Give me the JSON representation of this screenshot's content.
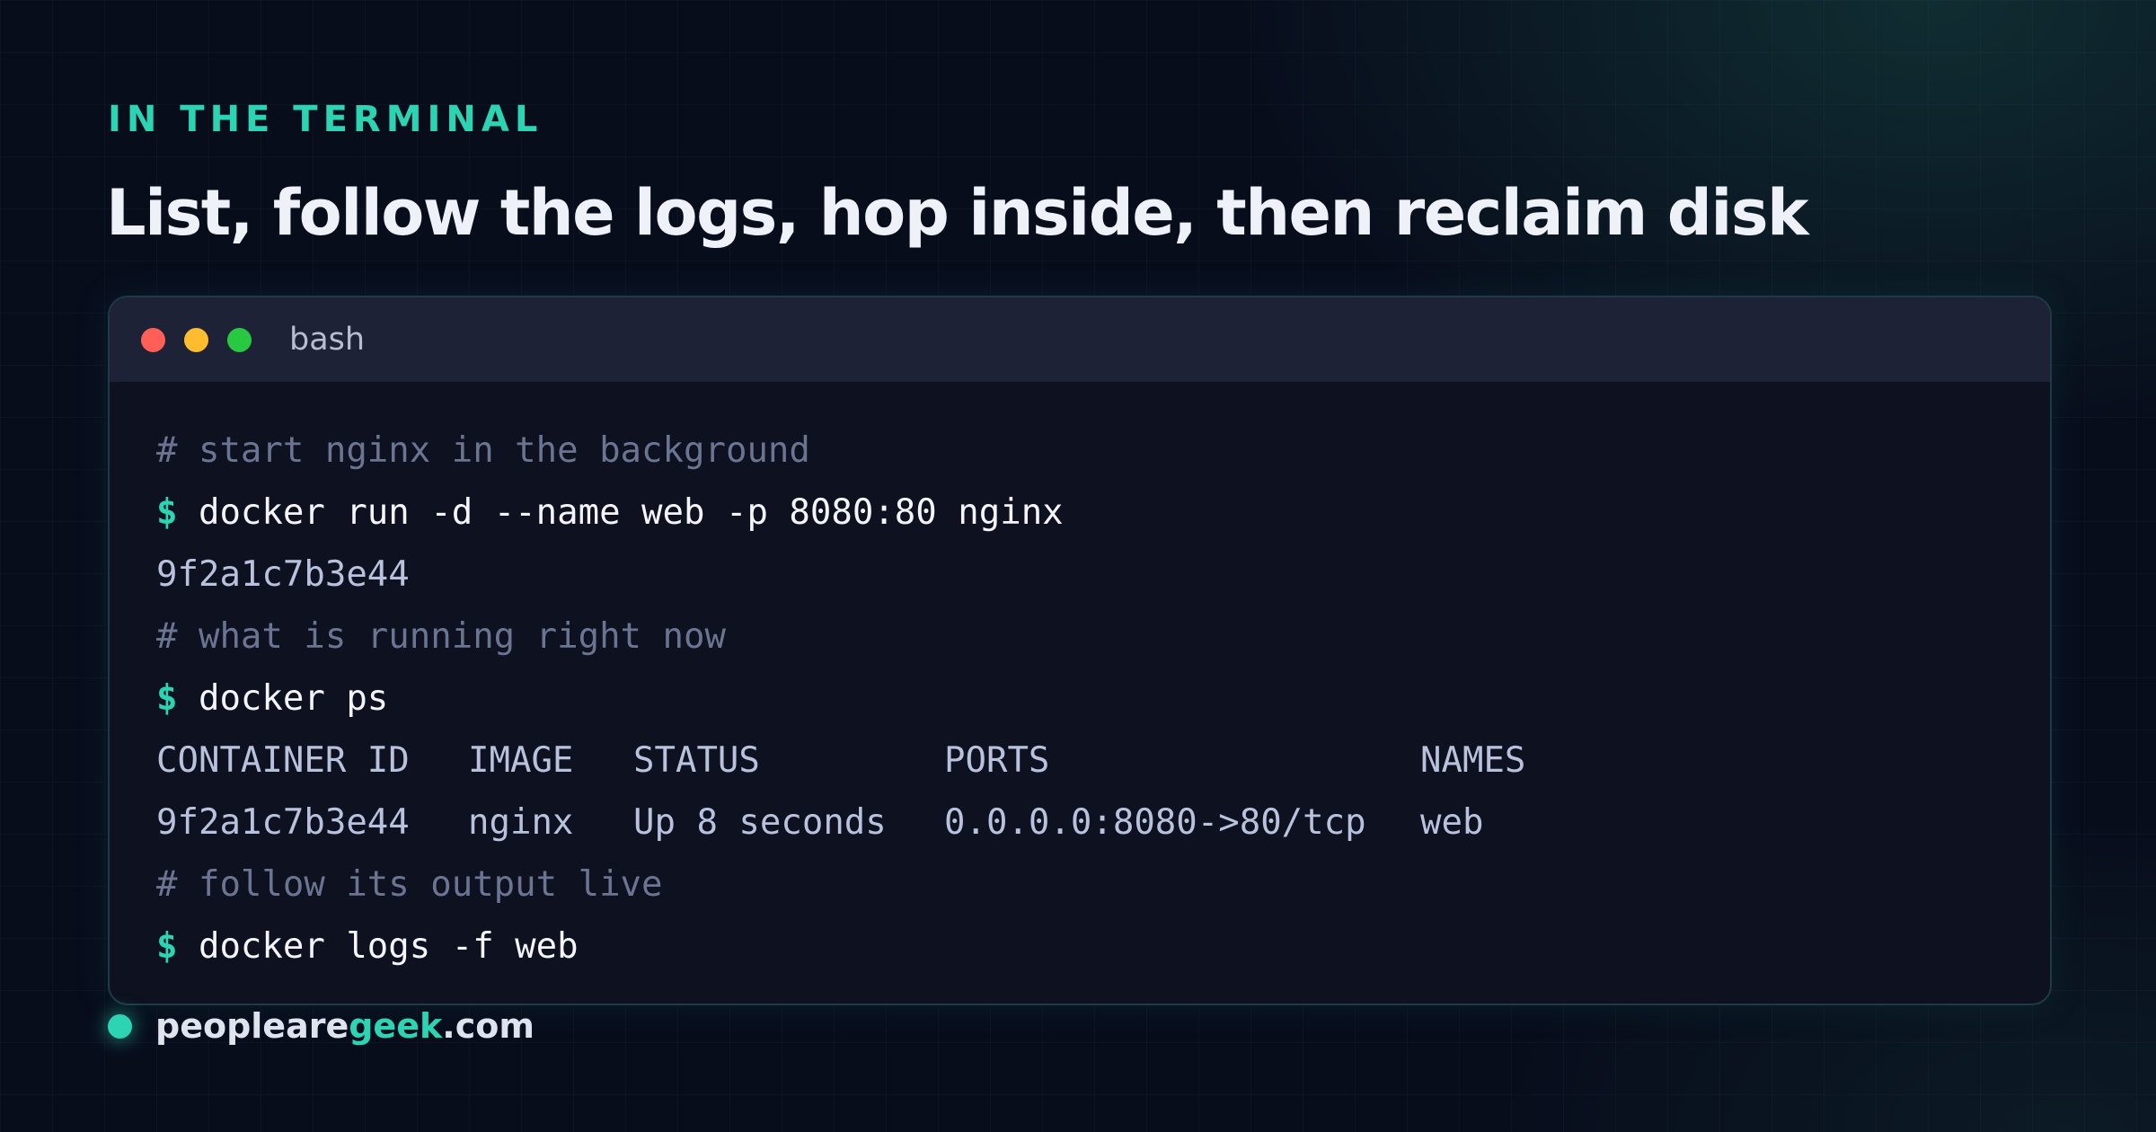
{
  "eyebrow": "IN THE TERMINAL",
  "headline": "List, follow the logs, hop inside, then reclaim disk",
  "window": {
    "title": "bash",
    "controls": [
      "close",
      "minimize",
      "maximize"
    ]
  },
  "terminal": {
    "prompt_symbol": "$",
    "lines": [
      {
        "type": "comment",
        "text": "# start nginx in the background"
      },
      {
        "type": "command",
        "text": "docker run -d --name web -p 8080:80 nginx"
      },
      {
        "type": "output",
        "text": "9f2a1c7b3e44"
      },
      {
        "type": "comment",
        "text": "# what is running right now"
      },
      {
        "type": "command",
        "text": "docker ps"
      },
      {
        "type": "table_row",
        "cells": [
          "CONTAINER ID",
          "IMAGE",
          "STATUS",
          "PORTS",
          "NAMES"
        ]
      },
      {
        "type": "table_row",
        "cells": [
          "9f2a1c7b3e44",
          "nginx",
          "Up 8 seconds",
          "0.0.0.0:8080->80/tcp",
          "web"
        ]
      },
      {
        "type": "comment",
        "text": "# follow its output live"
      },
      {
        "type": "command",
        "text": "docker logs -f web"
      }
    ]
  },
  "footer": {
    "brand_prefix": "peopleare",
    "brand_accent": "geek",
    "brand_suffix": ".com"
  },
  "colors": {
    "accent": "#2dd4b4",
    "background": "#080d1c",
    "window_titlebar": "#1d2236",
    "window_body": "#0d1120",
    "close": "#ff5f57",
    "minimize": "#febc2e",
    "maximize": "#28c840"
  }
}
